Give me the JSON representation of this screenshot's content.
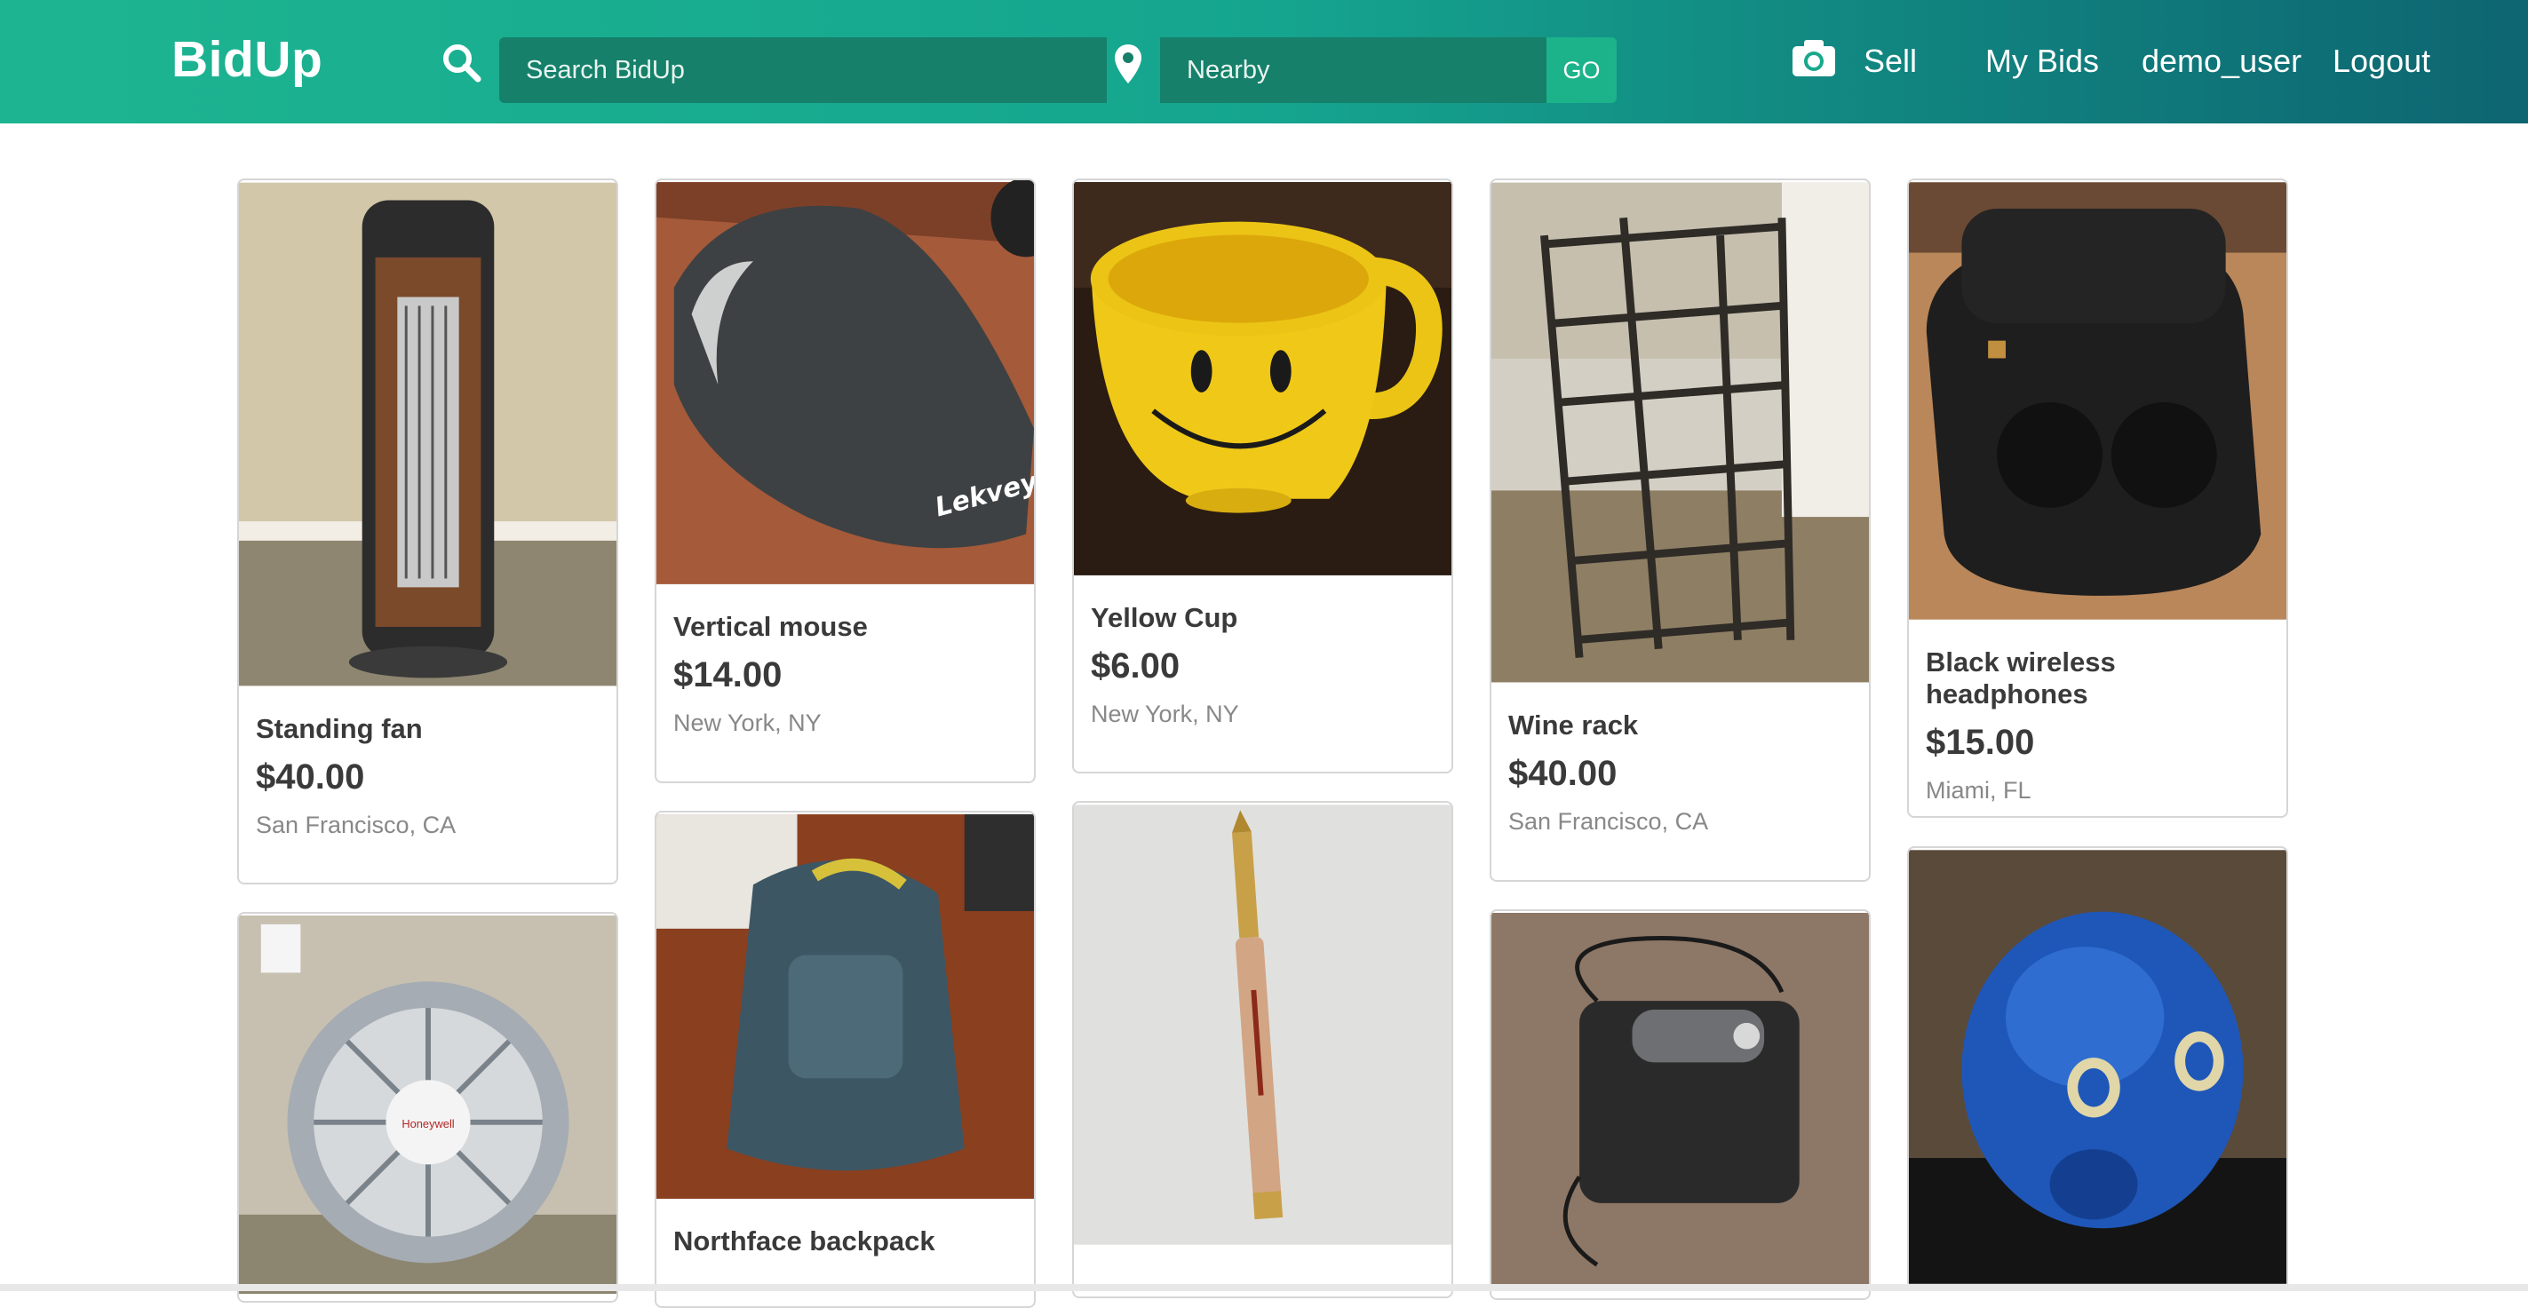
{
  "header": {
    "logo": "BidUp",
    "search_placeholder": "Search BidUp",
    "location_placeholder": "Nearby",
    "go_label": "GO",
    "nav": {
      "sell": "Sell",
      "my_bids": "My Bids",
      "user": "demo_user",
      "logout": "Logout"
    }
  },
  "listings": [
    {
      "title": "Standing fan",
      "price": "$40.00",
      "location": "San Francisco, CA"
    },
    {
      "title": "Vertical mouse",
      "price": "$14.00",
      "location": "New York, NY"
    },
    {
      "title": "Yellow Cup",
      "price": "$6.00",
      "location": "New York, NY"
    },
    {
      "title": "Wine rack",
      "price": "$40.00",
      "location": "San Francisco, CA"
    },
    {
      "title": "Black wireless headphones",
      "price": "$15.00",
      "location": "Miami, FL"
    },
    {
      "title": "Northface backpack"
    }
  ],
  "colors": {
    "header_start": "#1db591",
    "header_end": "#0d6571",
    "input_bg": "#16806a"
  }
}
